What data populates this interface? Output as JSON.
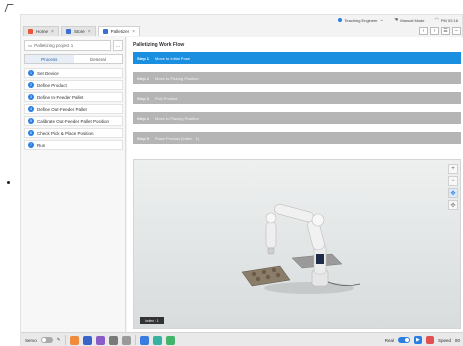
{
  "status": {
    "role": "Teaching Engineer",
    "mode": "Manual Mode",
    "time": "PM 02:16"
  },
  "tabs": [
    {
      "label": "Home",
      "color": "#e8573a"
    },
    {
      "label": "Store",
      "color": "#3a6fd0"
    },
    {
      "label": "Palletizer",
      "color": "#3a6fd0"
    }
  ],
  "left": {
    "project_name": "Palletizing project 1",
    "more": "...",
    "subtabs": [
      "Process",
      "General"
    ],
    "steps": [
      {
        "n": "1",
        "label": "Set Device"
      },
      {
        "n": "2",
        "label": "Define Product"
      },
      {
        "n": "3",
        "label": "Define In-Feeder Pallet"
      },
      {
        "n": "4",
        "label": "Define Out-Feeder Pallet"
      },
      {
        "n": "5",
        "label": "Calibrate Out-Feeder Pallet Position"
      },
      {
        "n": "6",
        "label": "Check Pick & Place Position"
      },
      {
        "n": "7",
        "label": "Run"
      }
    ]
  },
  "main": {
    "title": "Palletizing Work Flow",
    "flow": [
      {
        "step": "Step 1",
        "text": "Move to Initial Pose"
      },
      {
        "step": "Step 2",
        "text": "Move to Picking Position"
      },
      {
        "step": "Step 3",
        "text": "Pick Product"
      },
      {
        "step": "Step 4",
        "text": "Move to Placing Position"
      },
      {
        "step": "Step 5",
        "text": "Place Product (Index : 1)"
      }
    ],
    "viewport_index": "Index : 1",
    "viewport_tools": [
      "+",
      "−",
      "✥",
      "✣"
    ]
  },
  "bottom": {
    "servo": "Servo",
    "real": "Real",
    "speed": "Speed",
    "speed_value": "80"
  },
  "colors": {
    "accent": "#1a8fe0",
    "inactive_step": "#b5b5b5"
  }
}
